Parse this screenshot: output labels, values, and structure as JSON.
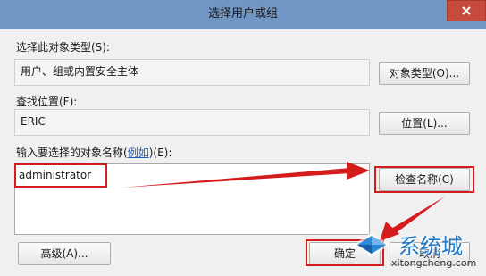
{
  "dialog": {
    "title": "选择用户或组",
    "close_icon": "close-icon"
  },
  "object_type": {
    "label": "选择此对象类型(S):",
    "value": "用户、组或内置安全主体",
    "button": "对象类型(O)..."
  },
  "location": {
    "label": "查找位置(F):",
    "value": "ERIC",
    "button": "位置(L)..."
  },
  "names": {
    "label_prefix": "输入要选择的对象名称(",
    "label_link": "例如",
    "label_suffix": ")(E):",
    "value": "administrator",
    "check_button": "检查名称(C)"
  },
  "footer": {
    "advanced_button": "高级(A)...",
    "ok_button": "确定",
    "cancel_button": "取消"
  },
  "annotations": {
    "highlight_color": "#d51c1c"
  },
  "watermark": {
    "brand": "系统城",
    "url": "xitongcheng.com"
  }
}
